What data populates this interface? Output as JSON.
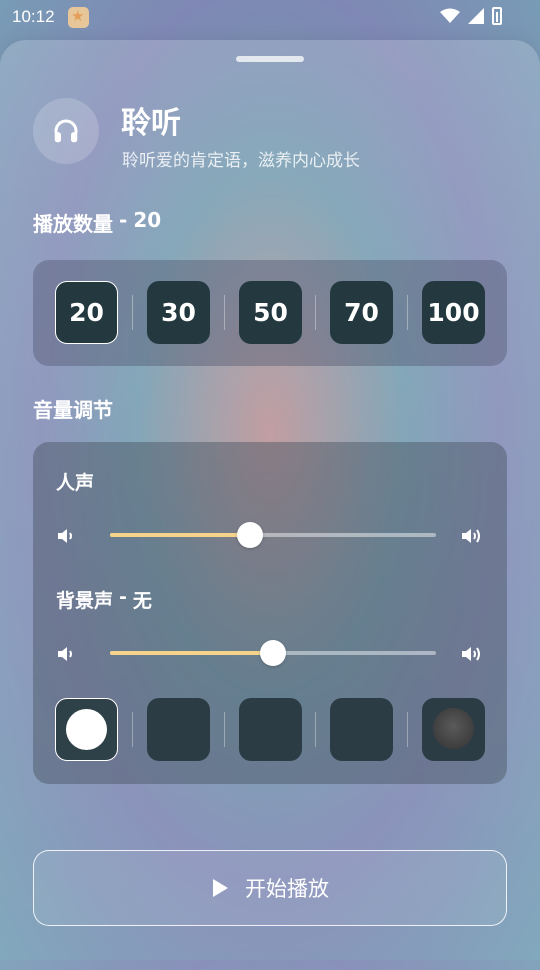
{
  "status_bar": {
    "time": "10:12"
  },
  "header": {
    "icon": "headphones-icon",
    "title": "聆听",
    "subtitle": "聆听爱的肯定语，滋养内心成长"
  },
  "play_count": {
    "label": "播放数量",
    "separator": "-",
    "selected_value": "20",
    "options": [
      "20",
      "30",
      "50",
      "70",
      "100"
    ]
  },
  "volume": {
    "section_title": "音量调节",
    "voice": {
      "label": "人声",
      "level": 0.43
    },
    "background": {
      "label": "背景声",
      "separator": "-",
      "selected_name": "无",
      "level": 0.5,
      "tiles": [
        {
          "kind": "none",
          "selected": true
        },
        {
          "kind": "blank",
          "selected": false
        },
        {
          "kind": "blank",
          "selected": false
        },
        {
          "kind": "blank",
          "selected": false
        },
        {
          "kind": "photo",
          "selected": false
        }
      ]
    }
  },
  "start_button": {
    "label": "开始播放",
    "icon": "play-icon"
  },
  "colors": {
    "slider_fill": "#f6d38b",
    "chip_bg": "#23393f"
  }
}
